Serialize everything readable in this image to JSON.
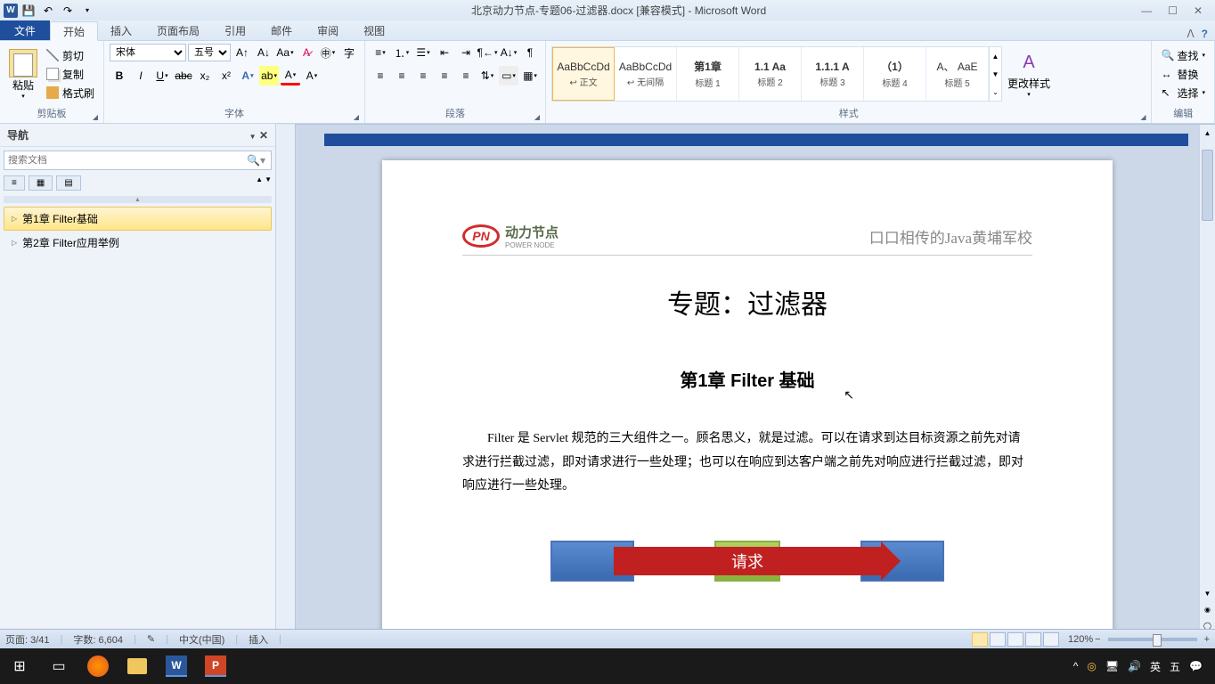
{
  "titlebar": {
    "title": "北京动力节点-专题06-过滤器.docx [兼容模式] - Microsoft Word"
  },
  "tabs": {
    "file": "文件",
    "items": [
      "开始",
      "插入",
      "页面布局",
      "引用",
      "邮件",
      "审阅",
      "视图"
    ]
  },
  "ribbon": {
    "clipboard": {
      "label": "剪贴板",
      "paste": "粘贴",
      "cut": "剪切",
      "copy": "复制",
      "format_painter": "格式刷"
    },
    "font": {
      "label": "字体",
      "name": "宋体",
      "size": "五号"
    },
    "paragraph": {
      "label": "段落"
    },
    "styles": {
      "label": "样式",
      "items": [
        {
          "preview": "AaBbCcDd",
          "name": "↩ 正文"
        },
        {
          "preview": "AaBbCcDd",
          "name": "↩ 无间隔"
        },
        {
          "preview": "第1章",
          "name": "标题 1"
        },
        {
          "preview": "1.1 Aa",
          "name": "标题 2"
        },
        {
          "preview": "1.1.1 A",
          "name": "标题 3"
        },
        {
          "preview": "（1）",
          "name": "标题 4"
        },
        {
          "preview": "A、 AaE",
          "name": "标题 5"
        }
      ],
      "change": "更改样式"
    },
    "editing": {
      "label": "编辑",
      "find": "查找",
      "replace": "替换",
      "select": "选择"
    }
  },
  "nav": {
    "title": "导航",
    "search_placeholder": "搜索文档",
    "items": [
      {
        "label": "第1章 Filter基础"
      },
      {
        "label": "第2章 Filter应用举例"
      }
    ]
  },
  "document": {
    "header_brand_cn": "动力节点",
    "header_brand_en": "POWER NODE",
    "header_right": "口口相传的Java黄埔军校",
    "title": "专题：过滤器",
    "h1": "第1章 Filter 基础",
    "p1": "Filter 是 Servlet 规范的三大组件之一。顾名思义，就是过滤。可以在请求到达目标资源之前先对请求进行拦截过滤，即对请求进行一些处理；也可以在响应到达客户端之前先对响应进行拦截过滤，即对响应进行一些处理。",
    "arrow_label": "请求"
  },
  "status": {
    "page": "页面: 3/41",
    "words": "字数: 6,604",
    "lang": "中文(中国)",
    "insert": "插入",
    "zoom": "120%"
  },
  "tray": {
    "ime1": "英",
    "ime2": "五"
  }
}
